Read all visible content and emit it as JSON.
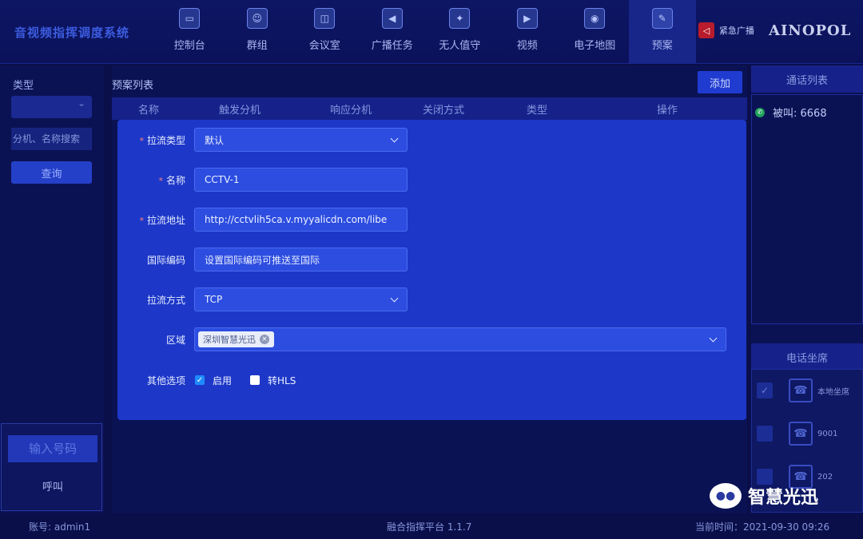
{
  "header": {
    "app_title": "音视频指挥调度系统",
    "nav": [
      {
        "label": "控制台",
        "icon": "monitor-icon"
      },
      {
        "label": "群组",
        "icon": "group-icon"
      },
      {
        "label": "会议室",
        "icon": "meeting-icon"
      },
      {
        "label": "广播任务",
        "icon": "megaphone-icon"
      },
      {
        "label": "无人值守",
        "icon": "unattended-icon"
      },
      {
        "label": "视频",
        "icon": "video-icon"
      },
      {
        "label": "电子地图",
        "icon": "map-icon"
      },
      {
        "label": "预案",
        "icon": "plan-icon",
        "active": true
      }
    ],
    "emergency_label": "紧急广播",
    "brand": "AINOPOL"
  },
  "left_panel": {
    "type_label": "类型",
    "search_placeholder": "分机、名称搜索",
    "query_label": "查询",
    "dial_placeholder": "输入号码",
    "call_label": "呼叫"
  },
  "center": {
    "list_title": "预案列表",
    "add_label": "添加",
    "columns": [
      "名称",
      "触发分机",
      "响应分机",
      "关闭方式",
      "类型",
      "操作"
    ]
  },
  "form": {
    "pull_type": {
      "label": "拉流类型",
      "value": "默认"
    },
    "name": {
      "label": "名称",
      "value": "CCTV-1"
    },
    "url": {
      "label": "拉流地址",
      "value": "http://cctvlih5ca.v.myyalicdn.com/libe"
    },
    "national_code": {
      "label": "国际编码",
      "placeholder": "设置国际编码可推送至国际"
    },
    "pull_method": {
      "label": "拉流方式",
      "value": "TCP"
    },
    "region": {
      "label": "区域",
      "tag": "深圳智慧光迅"
    },
    "options": {
      "label": "其他选项",
      "enable": "启用",
      "enable_checked": true,
      "hls": "转HLS",
      "hls_checked": false
    }
  },
  "right_panel": {
    "call_list_title": "通话列表",
    "call_item": "被叫: 6668",
    "seats_title": "电话坐席",
    "seats": [
      "本地坐席",
      "9001",
      "202"
    ]
  },
  "watermark": "智慧光迅",
  "footer": {
    "account": "账号: admin1",
    "platform": "融合指挥平台 1.1.7",
    "time": "当前时间：2021-09-30 09:26"
  }
}
